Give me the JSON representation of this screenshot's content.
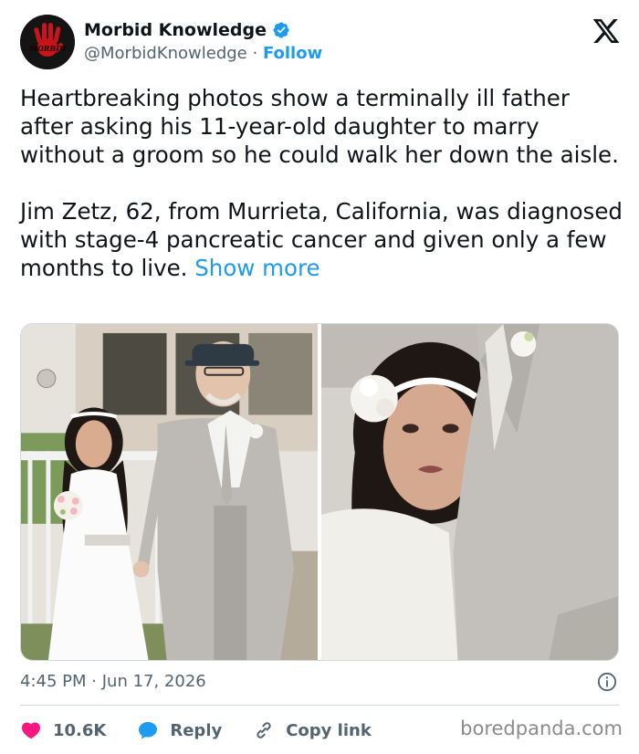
{
  "author": {
    "display_name": "Morbid Knowledge",
    "handle": "@MorbidKnowledge",
    "separator": "·",
    "follow_label": "Follow",
    "avatar_icon": "red-handprint-logo",
    "verified_icon": "verified-badge-icon",
    "avatar_text": "MORBID"
  },
  "platform_icon": "x-logo-icon",
  "tweet": {
    "paragraph_1": "Heartbreaking photos show a terminally ill father after asking his 11-year-old daughter to marry without a groom so he could walk her down the aisle.",
    "paragraph_2": "Jim Zetz, 62, from Murrieta, California, was diagnosed with stage-4 pancreatic cancer and given only a few months to live.",
    "show_more_label": "Show more"
  },
  "media": {
    "photos": [
      {
        "name": "wedding-walk-photo"
      },
      {
        "name": "daughter-crying-photo"
      }
    ]
  },
  "meta": {
    "time": "4:45 PM",
    "separator": "·",
    "date": "Jun 17, 2026",
    "info_icon": "info-icon"
  },
  "actions": {
    "likes_count": "10.6K",
    "reply_label": "Reply",
    "copy_link_label": "Copy link"
  },
  "watermark": "boredpanda.com",
  "colors": {
    "accent": "#1d9bf0",
    "like": "#f91880",
    "text": "#0f1419",
    "muted": "#536471"
  }
}
